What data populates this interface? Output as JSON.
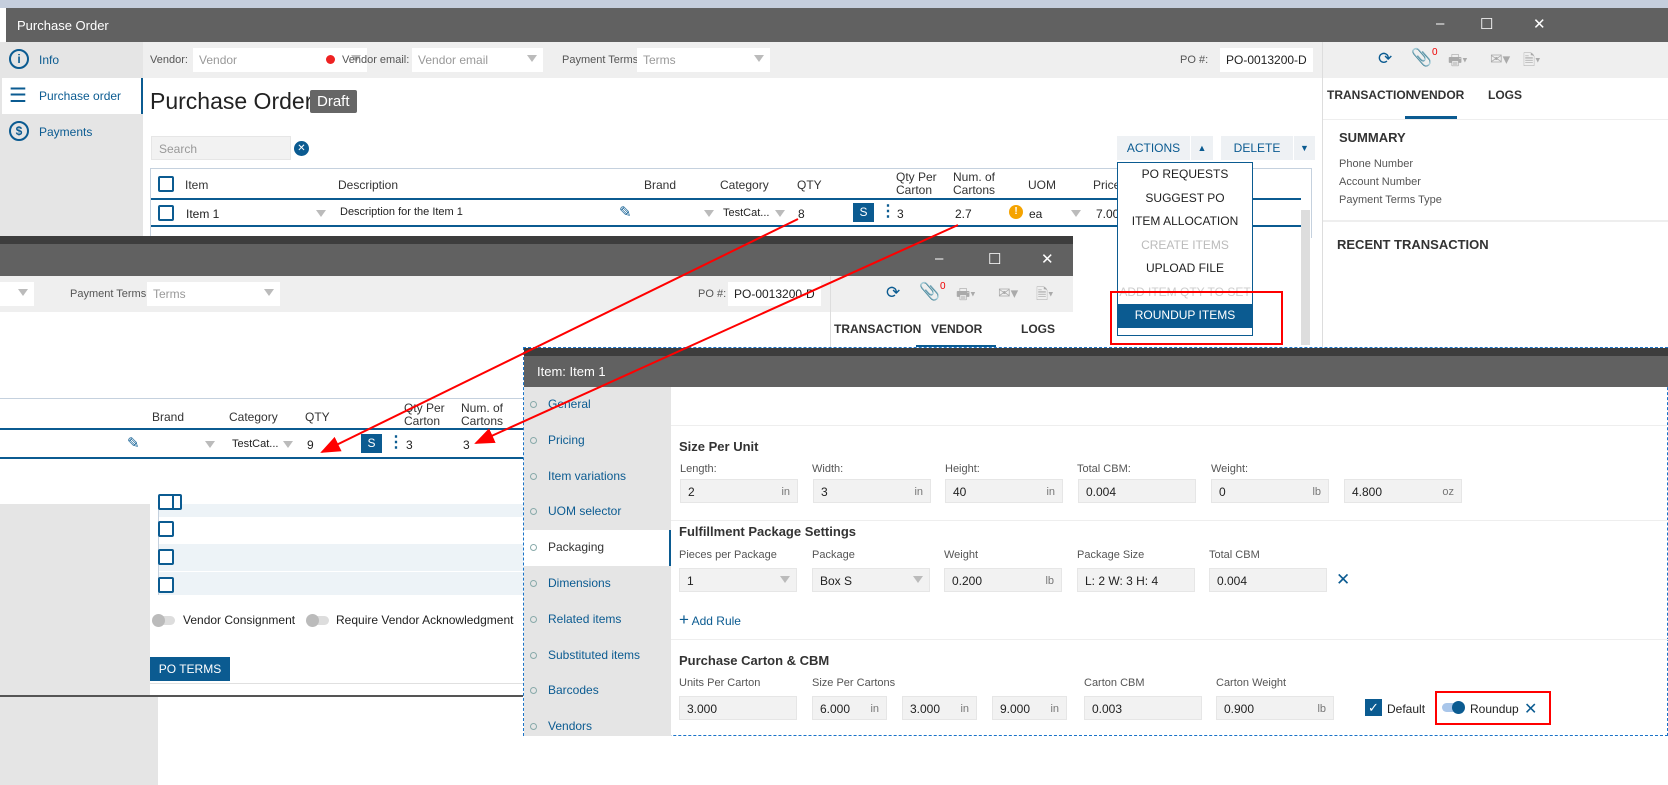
{
  "main_window": {
    "title": "Purchase Order",
    "controls": [
      "–",
      "☐",
      "✕"
    ],
    "sidebar": [
      {
        "label": "Info",
        "icon": "info-icon"
      },
      {
        "label": "Purchase order",
        "icon": "list-icon"
      },
      {
        "label": "Payments",
        "icon": "dollar-icon"
      }
    ],
    "toolbar": {
      "vendor_label": "Vendor:",
      "vendor_placeholder": "Vendor",
      "vendor_email_label": "Vendor email:",
      "vendor_email_placeholder": "Vendor email",
      "payment_terms_label": "Payment Terms:",
      "payment_terms_placeholder": "Terms",
      "po_label": "PO #:",
      "po_value": "PO-0013200-D",
      "attachment_count": "0"
    },
    "heading": "Purchase Order",
    "status": "Draft",
    "search_placeholder": "Search",
    "actions_label": "ACTIONS",
    "delete_label": "DELETE",
    "columns": [
      "Item",
      "Description",
      "Brand",
      "Category",
      "QTY",
      "Qty Per Carton",
      "Num. of Cartons",
      "UOM",
      "Price"
    ],
    "row": {
      "item": "Item 1",
      "description": "Description for the Item 1",
      "brand": "",
      "category": "TestCat...",
      "qty": "8",
      "s": "S",
      "qty_per_carton": "3",
      "num_cartons": "2.7",
      "uom": "ea",
      "price": "7.00"
    },
    "actions_menu": [
      {
        "label": "PO REQUESTS",
        "disabled": false
      },
      {
        "label": "SUGGEST PO",
        "disabled": false
      },
      {
        "label": "ITEM ALLOCATION",
        "disabled": false
      },
      {
        "label": "CREATE ITEMS",
        "disabled": true
      },
      {
        "label": "UPLOAD FILE",
        "disabled": false
      },
      {
        "label": "ADD ITEM QTY TO SET",
        "disabled": true
      },
      {
        "label": "ROUNDUP ITEMS",
        "selected": true
      }
    ],
    "right_tabs": [
      "TRANSACTION",
      "VENDOR",
      "LOGS"
    ],
    "active_tab": "VENDOR",
    "summary_title": "SUMMARY",
    "summary_fields": [
      "Phone Number",
      "Account Number",
      "Payment Terms Type"
    ],
    "recent_title": "RECENT TRANSACTION"
  },
  "second_window": {
    "controls": [
      "–",
      "☐",
      "✕"
    ],
    "payment_terms_label": "Payment Terms:",
    "payment_terms_placeholder": "Terms",
    "po_label": "PO #:",
    "po_value": "PO-0013200-D",
    "attachment_count": "0",
    "right_tabs": [
      "TRANSACTION",
      "VENDOR",
      "LOGS"
    ],
    "columns": [
      "Brand",
      "Category",
      "QTY",
      "Qty Per Carton",
      "Num. of Cartons"
    ],
    "row": {
      "category": "TestCat...",
      "qty": "9",
      "s": "S",
      "qty_per_carton": "3",
      "num_cartons": "3"
    },
    "toggles": [
      "Vendor Consignment",
      "Require Vendor Acknowledgment"
    ],
    "po_terms": "PO TERMS"
  },
  "item_dialog": {
    "title": "Item: Item 1",
    "nav": [
      "General",
      "Pricing",
      "Item variations",
      "UOM selector",
      "Packaging",
      "Dimensions",
      "Related items",
      "Substituted items",
      "Barcodes",
      "Vendors"
    ],
    "active_nav": "Packaging",
    "size_per_unit": {
      "title": "Size Per Unit",
      "fields": [
        {
          "label": "Length:",
          "value": "2",
          "unit": "in"
        },
        {
          "label": "Width:",
          "value": "3",
          "unit": "in"
        },
        {
          "label": "Height:",
          "value": "40",
          "unit": "in"
        },
        {
          "label": "Total CBM:",
          "value": "0.004",
          "unit": ""
        },
        {
          "label": "Weight:",
          "value": "0",
          "unit": "lb"
        },
        {
          "label": "",
          "value": "4.800",
          "unit": "oz"
        }
      ]
    },
    "fulfillment": {
      "title": "Fulfillment Package Settings",
      "labels": [
        "Pieces per Package",
        "Package",
        "Weight",
        "Package Size",
        "Total CBM"
      ],
      "pieces": "1",
      "package": "Box S",
      "weight": "0.200",
      "weight_unit": "lb",
      "package_size": "L: 2 W: 3 H: 4",
      "total_cbm": "0.004",
      "add_rule": "Add Rule"
    },
    "carton": {
      "title": "Purchase Carton & CBM",
      "labels": [
        "Units Per Carton",
        "Size Per Cartons",
        "Carton CBM",
        "Carton Weight"
      ],
      "units": "3.000",
      "size": [
        {
          "value": "6.000",
          "unit": "in"
        },
        {
          "value": "3.000",
          "unit": "in"
        },
        {
          "value": "9.000",
          "unit": "in"
        }
      ],
      "cbm": "0.003",
      "weight": "0.900",
      "weight_unit": "lb",
      "default_label": "Default",
      "default_checked": true,
      "roundup_label": "Roundup",
      "roundup_on": true
    }
  },
  "colors": {
    "accent": "#0b5b91",
    "titlebar": "#616161",
    "annotation": "#ff0000"
  }
}
